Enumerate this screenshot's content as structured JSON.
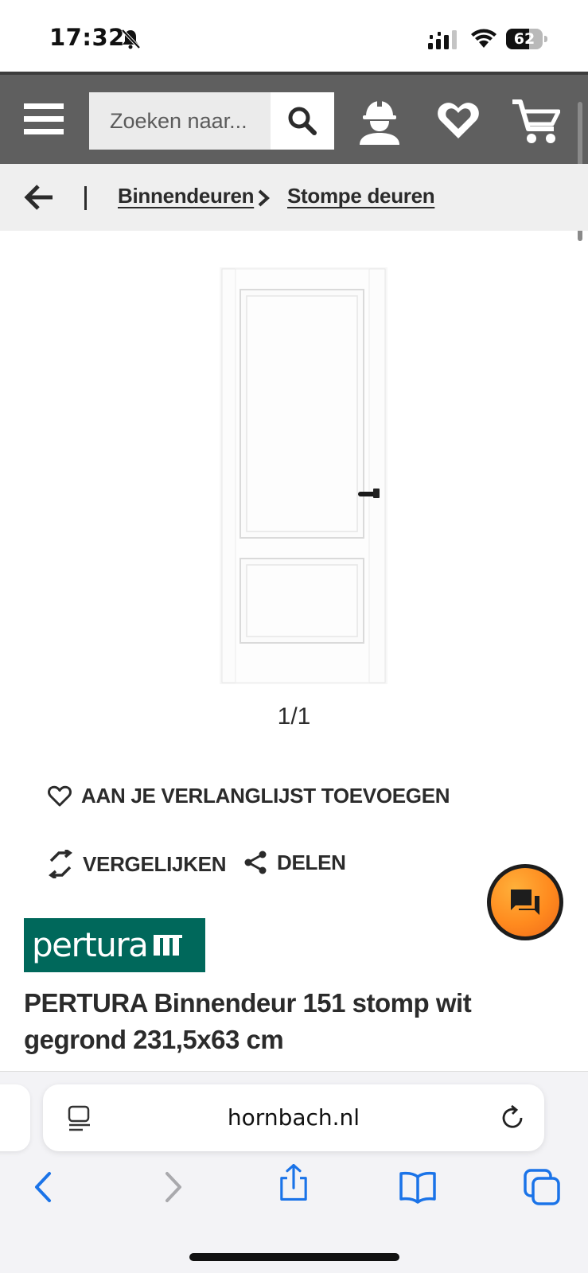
{
  "status_bar": {
    "time": "17:32",
    "battery_level": "62",
    "battery_fraction": 0.62,
    "icons": [
      "bell-slash-icon",
      "signal-icon",
      "wifi-icon",
      "battery-icon"
    ]
  },
  "header": {
    "search_placeholder": "Zoeken naar...",
    "icons": [
      "menu-icon",
      "search-icon",
      "worker-icon",
      "heart-icon",
      "cart-icon"
    ],
    "background_color": "#5f5f5f"
  },
  "breadcrumb": {
    "items": [
      {
        "label": "Binnendeuren"
      },
      {
        "label": "Stompe deuren"
      }
    ]
  },
  "gallery": {
    "counter": "1/1"
  },
  "actions": {
    "wishlist": "AAN JE VERLANGLIJST TOEVOEGEN",
    "compare": "VERGELIJKEN",
    "share": "DELEN"
  },
  "product": {
    "brand": "pertura",
    "brand_color": "#00685b",
    "title": "PERTURA Binnendeur 151 stomp wit gegrond 231,5x63 cm"
  },
  "chat": {
    "icon": "chat-icon",
    "color": "#ff8a1e"
  },
  "browser": {
    "url": "hornbach.nl",
    "accent_color": "#1a73e8",
    "toolbar_icons": [
      "back-icon",
      "forward-icon",
      "share-icon",
      "bookmarks-icon",
      "tabs-icon"
    ]
  }
}
